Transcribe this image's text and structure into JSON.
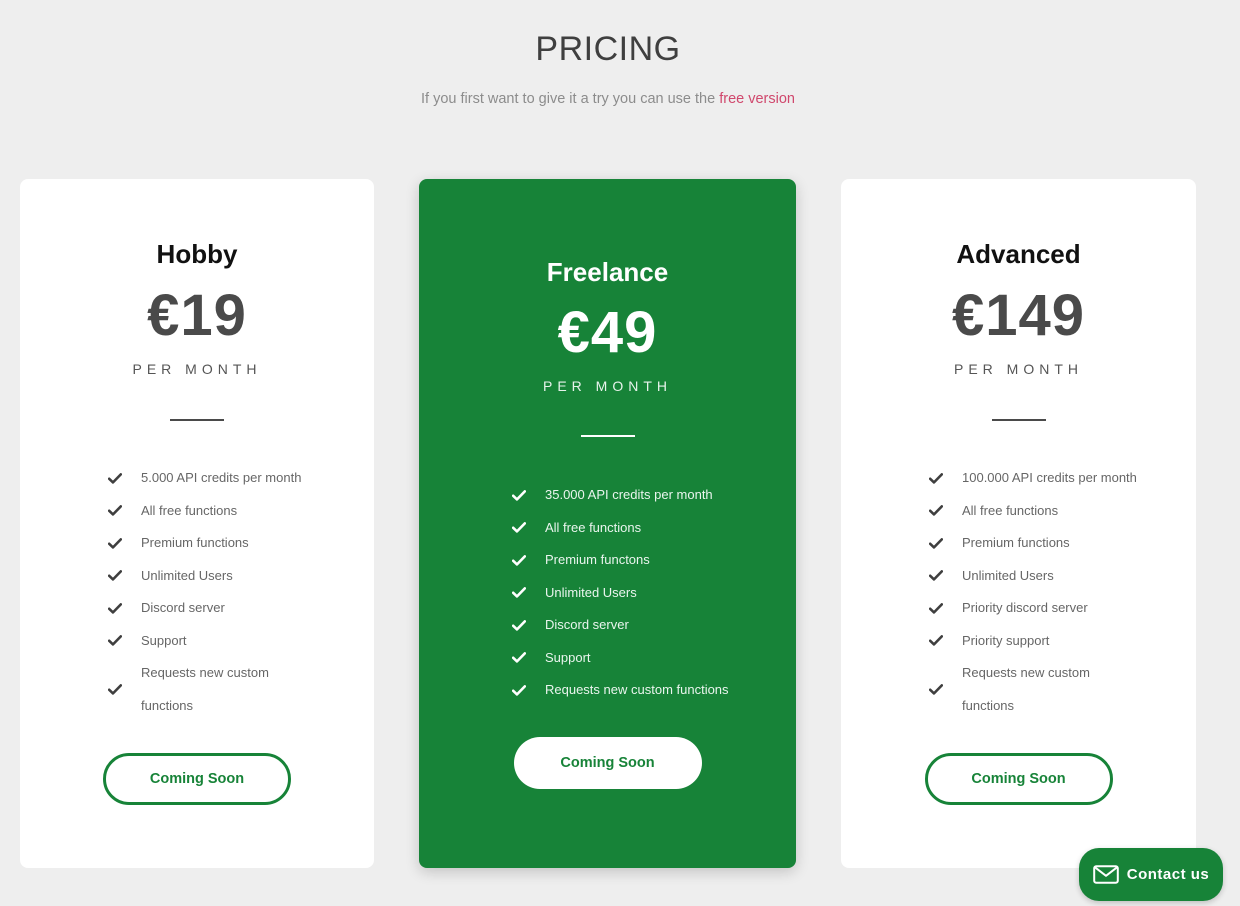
{
  "header": {
    "title": "PRICING",
    "subtitle_text": "If you first want to give it a try you can use the ",
    "subtitle_link": "free version"
  },
  "colors": {
    "accent": "#178338",
    "link": "#d0486d",
    "background": "#eeeeee"
  },
  "plans": [
    {
      "name": "Hobby",
      "price": "€19",
      "period": "PER MONTH",
      "features": [
        "5.000 API credits per month",
        "All free functions",
        "Premium functions",
        "Unlimited Users",
        "Discord server",
        "Support",
        "Requests new custom functions"
      ],
      "button": "Coming Soon"
    },
    {
      "name": "Freelance",
      "price": "€49",
      "period": "PER MONTH",
      "features": [
        "35.000 API credits per month",
        "All free functions",
        "Premium functons",
        "Unlimited Users",
        "Discord server",
        "Support",
        "Requests new custom functions"
      ],
      "button": "Coming Soon"
    },
    {
      "name": "Advanced",
      "price": "€149",
      "period": "PER MONTH",
      "features": [
        "100.000 API credits per month",
        "All free functions",
        "Premium functions",
        "Unlimited Users",
        "Priority discord server",
        "Priority support",
        "Requests new custom functions"
      ],
      "button": "Coming Soon"
    }
  ],
  "contact": {
    "label": "Contact us",
    "icon": "envelope-icon"
  }
}
